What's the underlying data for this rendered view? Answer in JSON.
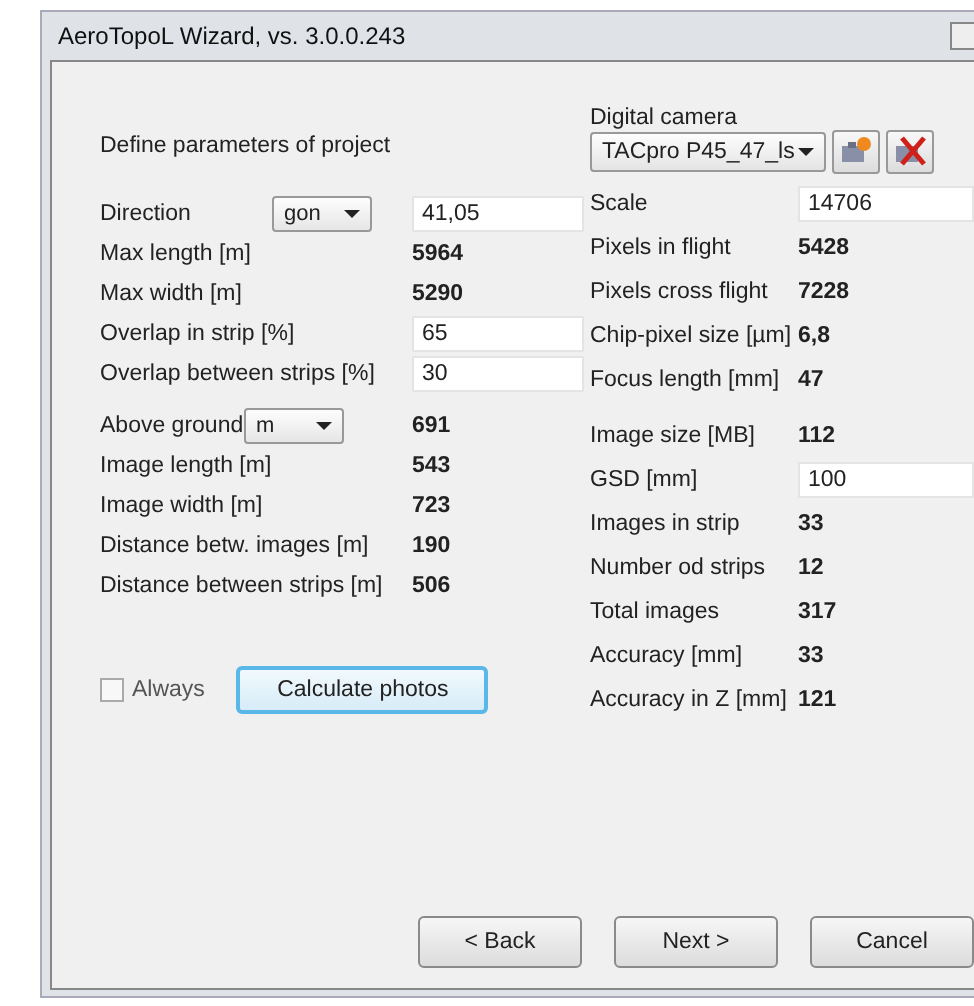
{
  "window": {
    "title": "AeroTopoL Wizard, vs. 3.0.0.243"
  },
  "left": {
    "heading": "Define parameters of project",
    "rows": [
      {
        "kind": "select_input",
        "label": "Direction",
        "select": "gon",
        "value": "41,05"
      },
      {
        "kind": "value",
        "label": "Max length [m]",
        "value": "5964"
      },
      {
        "kind": "value",
        "label": "Max width [m]",
        "value": "5290"
      },
      {
        "kind": "input",
        "label": "Overlap in strip [%]",
        "value": "65"
      },
      {
        "kind": "input",
        "label": "Overlap between strips [%]",
        "value": "30"
      },
      {
        "kind": "select_value",
        "label": "Above ground",
        "select": "m",
        "value": "691"
      },
      {
        "kind": "value",
        "label": "Image length [m]",
        "value": "543"
      },
      {
        "kind": "value",
        "label": "Image width [m]",
        "value": "723"
      },
      {
        "kind": "value",
        "label": "Distance betw. images [m]",
        "value": "190"
      },
      {
        "kind": "value",
        "label": "Distance between strips [m]",
        "value": "506"
      }
    ]
  },
  "always": {
    "label": "Always",
    "checked": false
  },
  "calculate_button": "Calculate photos",
  "right": {
    "camera_label": "Digital camera",
    "camera": "TACpro P45_47_ls",
    "rows": [
      {
        "kind": "input",
        "label": "Scale",
        "value": "14706"
      },
      {
        "kind": "value",
        "label": "Pixels in flight",
        "value": "5428"
      },
      {
        "kind": "value",
        "label": "Pixels cross flight",
        "value": "7228"
      },
      {
        "kind": "value",
        "label": "Chip-pixel size [µm]",
        "value": "6,8"
      },
      {
        "kind": "value",
        "label": "Focus length [mm]",
        "value": "47"
      },
      {
        "kind": "value",
        "label": "Image size [MB]",
        "value": "112"
      },
      {
        "kind": "input",
        "label": "GSD [mm]",
        "value": "100"
      },
      {
        "kind": "value",
        "label": "Images in  strip",
        "value": "33"
      },
      {
        "kind": "value",
        "label": "Number od strips",
        "value": "12"
      },
      {
        "kind": "value",
        "label": "Total images",
        "value": "317"
      },
      {
        "kind": "value",
        "label": "Accuracy [mm]",
        "value": "33"
      },
      {
        "kind": "value",
        "label": "Accuracy in Z [mm]",
        "value": "121"
      }
    ]
  },
  "buttons": [
    "< Back",
    "Next >",
    "Cancel"
  ]
}
